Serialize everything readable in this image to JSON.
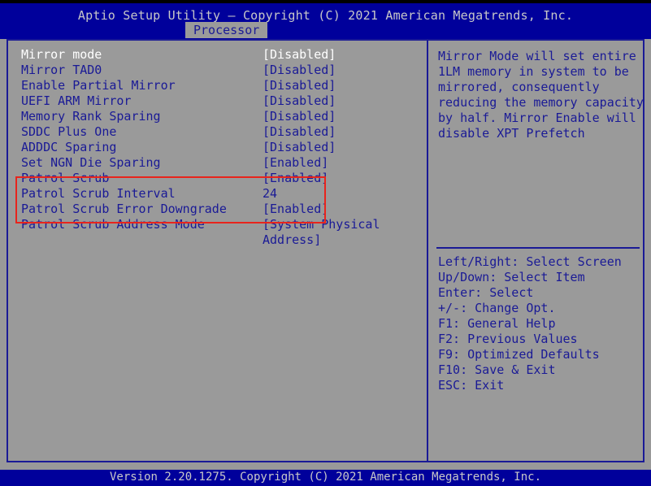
{
  "app": {
    "title": "Aptio Setup Utility – Copyright (C) 2021 American Megatrends, Inc.",
    "footer": "Version 2.20.1275. Copyright (C) 2021 American Megatrends, Inc."
  },
  "tabs": [
    {
      "label": "Processor",
      "active": true
    }
  ],
  "colors": {
    "header_blue": "#00009b",
    "body_gray": "#999999",
    "text_blue": "#1a1a96",
    "selected_white": "#ffffff",
    "annotation_red": "#e8241c",
    "footer_text": "#c8c8c8"
  },
  "settings": [
    {
      "label": "Mirror mode",
      "value": "[Disabled]",
      "selected": true,
      "highlighted": false
    },
    {
      "label": "Mirror TAD0",
      "value": "[Disabled]",
      "selected": false,
      "highlighted": false
    },
    {
      "label": "Enable Partial Mirror",
      "value": "[Disabled]",
      "selected": false,
      "highlighted": false
    },
    {
      "label": "UEFI ARM Mirror",
      "value": "[Disabled]",
      "selected": false,
      "highlighted": false
    },
    {
      "label": "Memory Rank Sparing",
      "value": "[Disabled]",
      "selected": false,
      "highlighted": false
    },
    {
      "label": "SDDC Plus One",
      "value": "[Disabled]",
      "selected": false,
      "highlighted": false
    },
    {
      "label": "ADDDC Sparing",
      "value": "[Disabled]",
      "selected": false,
      "highlighted": false
    },
    {
      "label": "Set NGN Die Sparing",
      "value": "[Enabled]",
      "selected": false,
      "highlighted": false
    },
    {
      "label": "Patrol Scrub",
      "value": "[Enabled]",
      "selected": false,
      "highlighted": true
    },
    {
      "label": "Patrol Scrub Interval",
      "value": "24",
      "selected": false,
      "highlighted": true
    },
    {
      "label": "Patrol Scrub Error Downgrade",
      "value": "[Enabled]",
      "selected": false,
      "highlighted": true
    },
    {
      "label": "Patrol Scrub Address Mode",
      "value": "[System Physical",
      "value_cont": "Address]",
      "selected": false,
      "highlighted": false
    }
  ],
  "help": {
    "lines": [
      "Mirror Mode will set entire",
      "1LM memory in system to be",
      "mirrored, consequently",
      "reducing the memory capacity",
      "by half. Mirror Enable will",
      "disable XPT Prefetch"
    ]
  },
  "key_legend": {
    "lines": [
      "Left/Right: Select Screen",
      "Up/Down: Select Item",
      "Enter: Select",
      "+/-: Change Opt.",
      "F1: General Help",
      "F2: Previous Values",
      "F9: Optimized Defaults",
      "F10: Save & Exit",
      "ESC: Exit"
    ]
  }
}
